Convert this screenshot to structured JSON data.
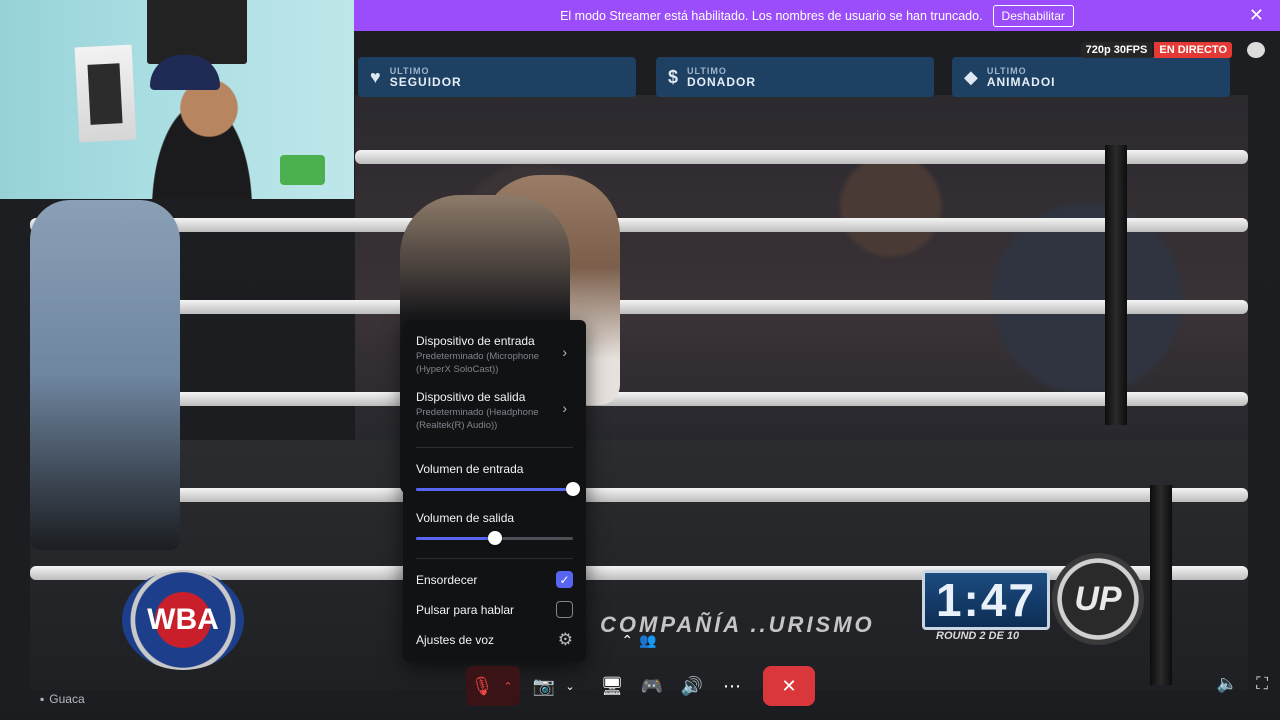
{
  "banner": {
    "message": "El modo Streamer está habilitado. Los nombres de usuario se han truncado.",
    "disable_label": "Deshabilitar",
    "close_icon": "close-icon"
  },
  "stream": {
    "quality_badge": "720p 30FPS",
    "live_badge": "EN DIRECTO",
    "overlay": [
      {
        "top": "ULTIMO",
        "bottom": "SEGUIDOR",
        "icon": "heart-icon"
      },
      {
        "top": "ULTIMO",
        "bottom": "DONADOR",
        "icon": "dollar-icon"
      },
      {
        "top": "ULTIMO",
        "bottom": "ANIMADOI",
        "icon": "diamond-icon"
      }
    ],
    "scoreboard_time": "1:47",
    "round_label": "ROUND 2 DE 10",
    "wba_text": "WBA",
    "up_text": "UP",
    "sponsor_text": "COMPAÑÍA ..URISMO"
  },
  "audio_menu": {
    "input_device": {
      "title": "Dispositivo de entrada",
      "subtitle": "Predeterminado (Microphone (HyperX SoloCast))"
    },
    "output_device": {
      "title": "Dispositivo de salida",
      "subtitle": "Predeterminado (Headphone (Realtek(R) Audio))"
    },
    "input_volume": {
      "label": "Volumen de entrada",
      "value": 1.0
    },
    "output_volume": {
      "label": "Volumen de salida",
      "value": 0.5
    },
    "deafen": {
      "label": "Ensordecer",
      "checked": true
    },
    "push_to_talk": {
      "label": "Pulsar para hablar",
      "checked": false
    },
    "voice_settings": {
      "label": "Ajustes de voz"
    }
  },
  "controls": {
    "mic": "muted-mic-icon",
    "camera": "camera-off-icon",
    "share": "screen-share-icon",
    "activity": "gamepad-icon",
    "soundboard": "soundboard-icon",
    "more": "more-icon",
    "hangup": "hangup-icon"
  },
  "name_tag": "Guaca",
  "colors": {
    "banner": "#9b4dfb",
    "accent": "#5865f2",
    "live": "#e53935",
    "hangup": "#da373c"
  }
}
